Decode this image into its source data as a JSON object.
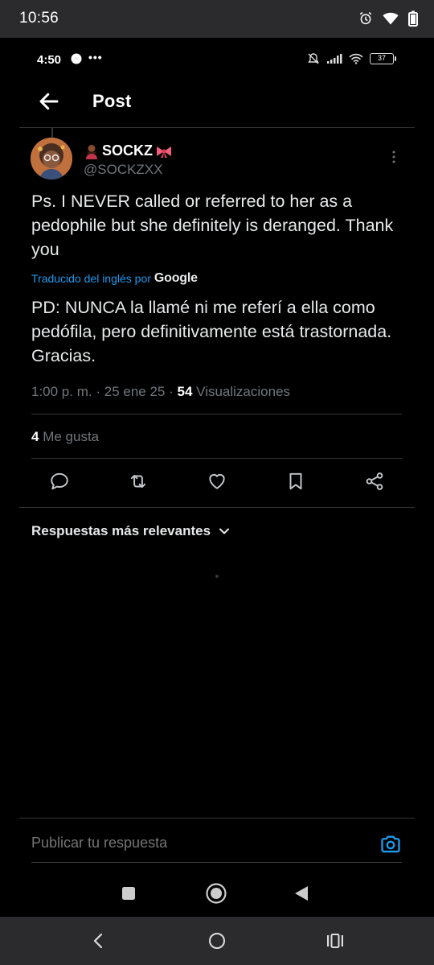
{
  "outer_status": {
    "time": "10:56"
  },
  "inner_status": {
    "time": "4:50",
    "battery": "37"
  },
  "topbar": {
    "title": "Post"
  },
  "post": {
    "display_name": "SOCKZ",
    "handle": "@SOCKZXX",
    "text": "Ps. I NEVER called or referred to her as a pedophile but she definitely is deranged. Thank you",
    "translated_label": "Traducido del inglés por",
    "translator": "Google",
    "translation": "PD: NUNCA la llamé ni me referí a ella como pedófila, pero definitivamente está trastornada. Gracias.",
    "time": "1:00 p. m.",
    "date": "25 ene 25",
    "views_count": "54",
    "views_label": "Visualizaciones",
    "likes_count": "4",
    "likes_label": "Me gusta"
  },
  "replies": {
    "sort_label": "Respuestas más relevantes"
  },
  "reply_box": {
    "placeholder": "Publicar tu respuesta"
  },
  "colors": {
    "accent": "#1d9bf0",
    "background": "#000000",
    "muted": "#71767b"
  }
}
